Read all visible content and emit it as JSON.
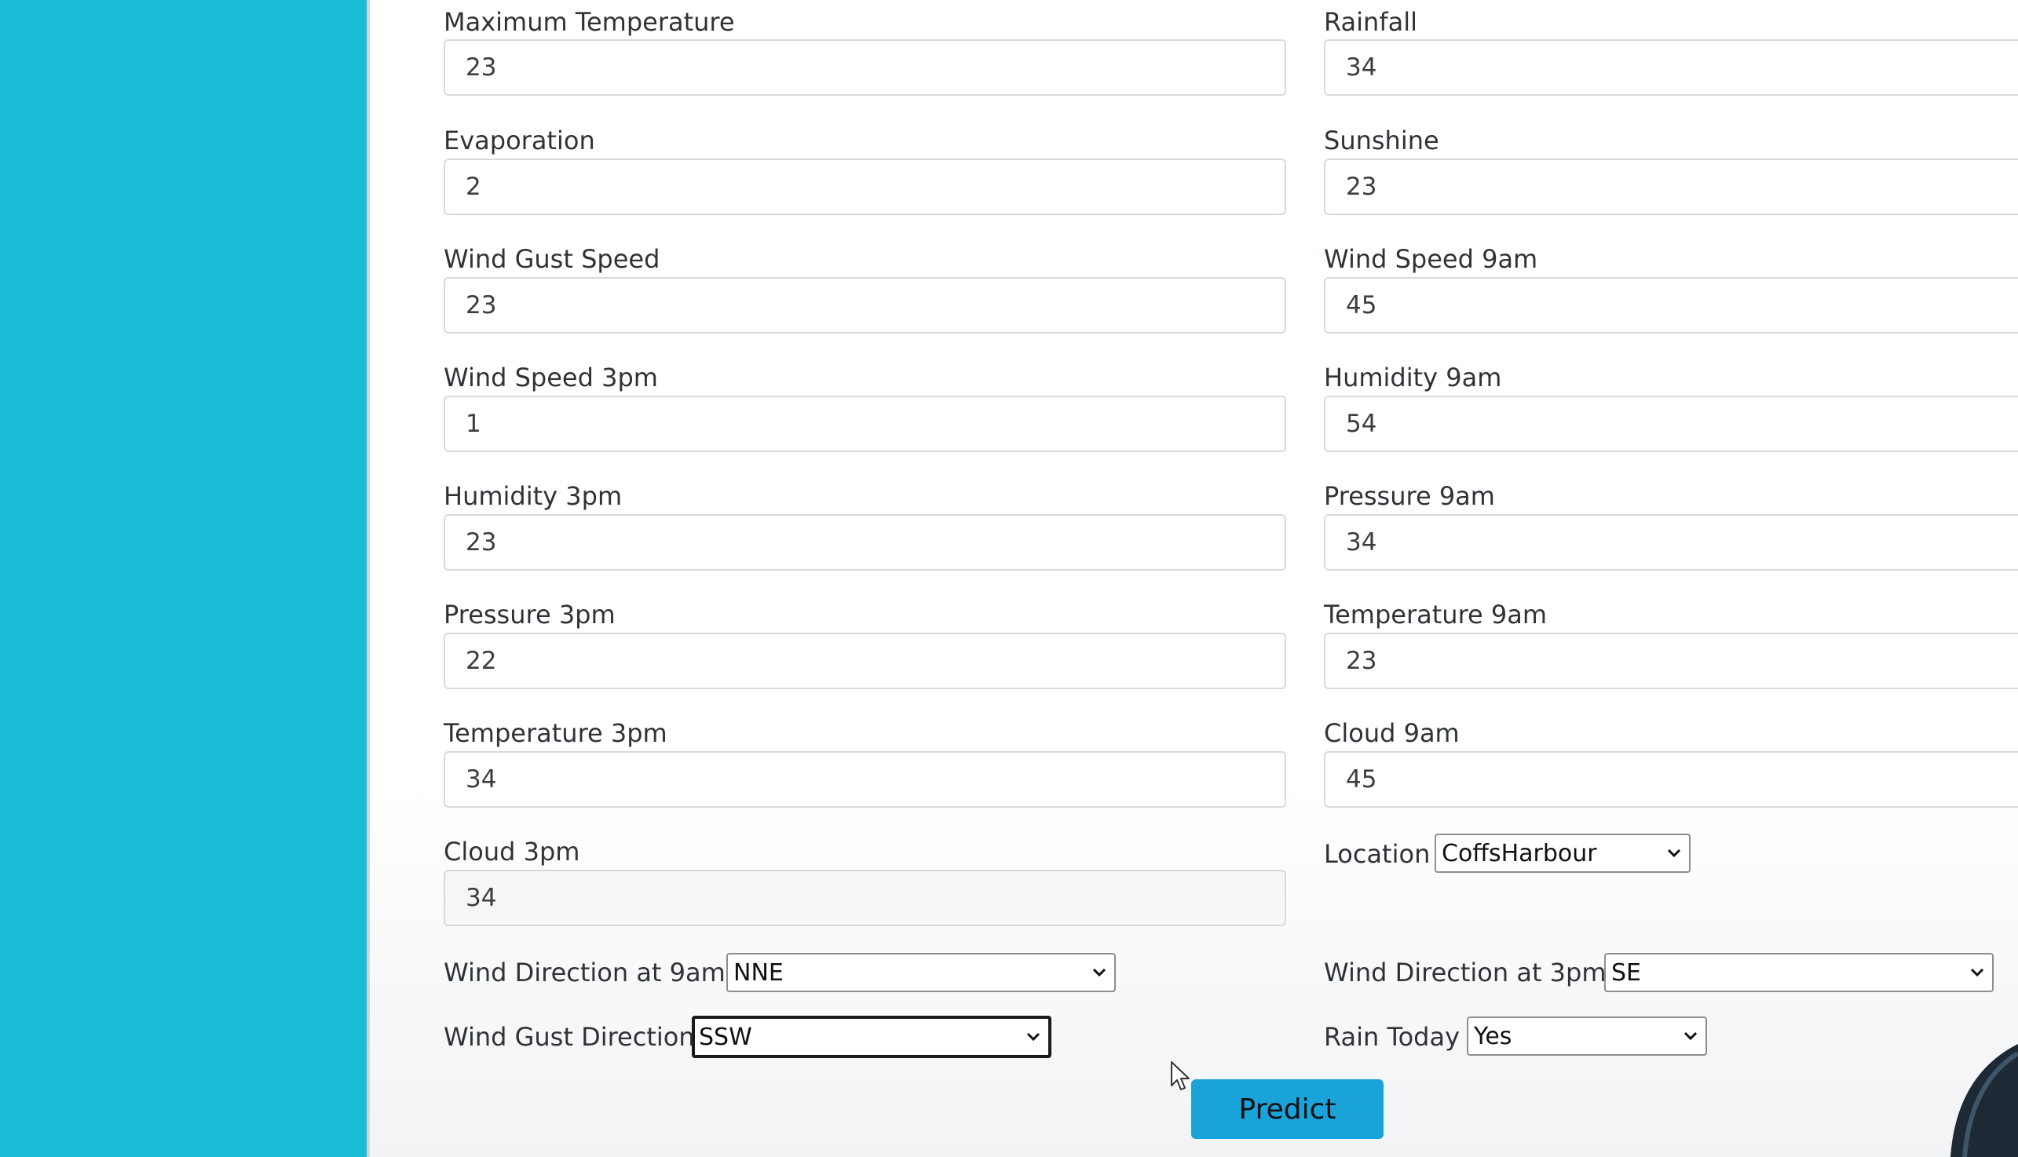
{
  "left_fields": [
    {
      "label": "Maximum Temperature",
      "value": "23"
    },
    {
      "label": "Evaporation",
      "value": "2"
    },
    {
      "label": "Wind Gust Speed",
      "value": "23"
    },
    {
      "label": "Wind Speed 3pm",
      "value": "1"
    },
    {
      "label": "Humidity 3pm",
      "value": "23"
    },
    {
      "label": "Pressure 3pm",
      "value": "22"
    },
    {
      "label": "Temperature 3pm",
      "value": "34"
    },
    {
      "label": "Cloud 3pm",
      "value": "34"
    }
  ],
  "right_fields": [
    {
      "label": "Rainfall",
      "value": "34"
    },
    {
      "label": "Sunshine",
      "value": "23"
    },
    {
      "label": "Wind Speed 9am",
      "value": "45"
    },
    {
      "label": "Humidity 9am",
      "value": "54"
    },
    {
      "label": "Pressure 9am",
      "value": "34"
    },
    {
      "label": "Temperature 9am",
      "value": "23"
    },
    {
      "label": "Cloud 9am",
      "value": "45"
    }
  ],
  "selects": {
    "location": {
      "label": "Location",
      "value": "CoffsHarbour"
    },
    "wind_dir_9am": {
      "label": "Wind Direction at 9am",
      "value": "NNE"
    },
    "wind_dir_3pm": {
      "label": "Wind Direction at 3pm",
      "value": "SE"
    },
    "wind_gust_dir": {
      "label": "Wind Gust Direction",
      "value": "SSW"
    },
    "rain_today": {
      "label": "Rain Today",
      "value": "Yes"
    }
  },
  "predict_button": {
    "label": "Predict"
  },
  "colors": {
    "sidebar": "#1bbcd8",
    "button": "#1aa3d9",
    "input_border": "#d6dadd"
  }
}
